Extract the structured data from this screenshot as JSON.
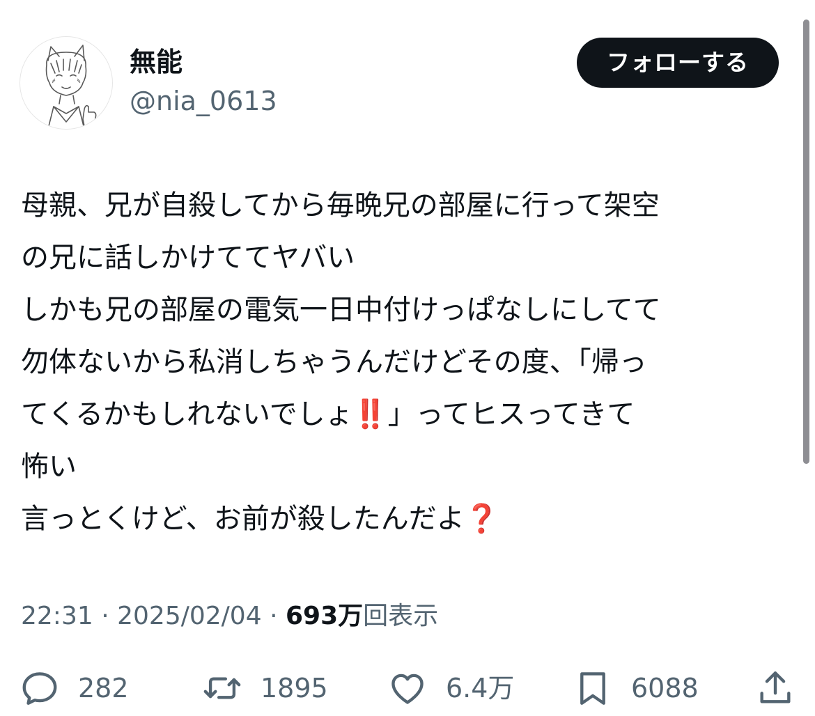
{
  "author": {
    "display_name": "無能",
    "handle": "@nia_0613",
    "avatar_icon": "cat-boy-illustration-avatar"
  },
  "follow_button": {
    "label": "フォローする"
  },
  "tweet": {
    "lines": [
      "母親、兄が自殺してから毎晩兄の部屋に行って架空",
      "の兄に話しかけててヤバい",
      "しかも兄の部屋の電気一日中付けっぱなしにしてて",
      "勿体ないから私消しちゃうんだけどその度、「帰っ",
      "てくるかもしれないでしょ‼️」ってヒスってきて",
      "怖い",
      "言っとくけど、お前が殺したんだよ❓"
    ]
  },
  "meta": {
    "time": "22:31",
    "date": "2025/02/04",
    "separator": "·",
    "views_number": "693万",
    "views_suffix": "回表示"
  },
  "actions": {
    "replies": "282",
    "retweets": "1895",
    "likes": "6.4万",
    "bookmarks": "6088",
    "icons": [
      "reply-icon",
      "retweet-icon",
      "like-icon",
      "bookmark-icon",
      "share-icon"
    ]
  },
  "colors": {
    "primary_text": "#0f1419",
    "secondary_text": "#536471",
    "follow_button_bg": "#0f1419",
    "emoji_red": "#e0201e"
  }
}
